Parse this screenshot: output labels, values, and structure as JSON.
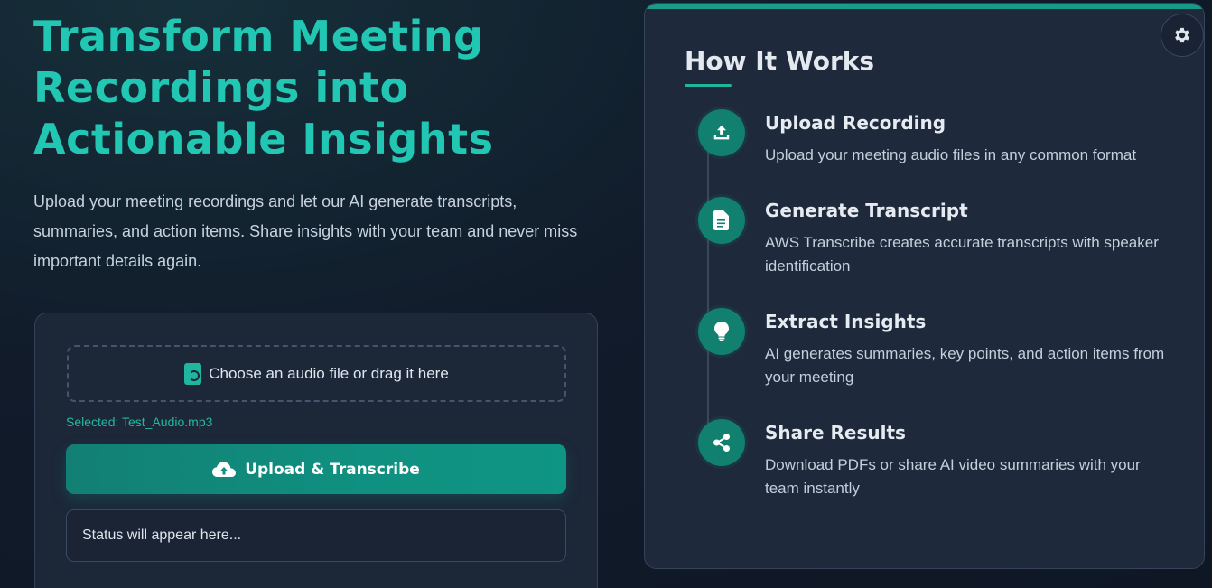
{
  "hero": {
    "title": "Transform Meeting Recordings into Actionable Insights",
    "subtitle": "Upload your meeting recordings and let our AI generate transcripts, summaries, and action items. Share insights with your team and never miss important details again."
  },
  "upload": {
    "dropzone_label": "Choose an audio file or drag it here",
    "selected_text": "Selected: Test_Audio.mp3",
    "button_label": "Upload & Transcribe",
    "status_placeholder": "Status will appear here..."
  },
  "how_it_works": {
    "title": "How It Works",
    "steps": [
      {
        "title": "Upload Recording",
        "desc": "Upload your meeting audio files in any common format",
        "icon": "upload-icon"
      },
      {
        "title": "Generate Transcript",
        "desc": "AWS Transcribe creates accurate transcripts with speaker identification",
        "icon": "document-icon"
      },
      {
        "title": "Extract Insights",
        "desc": "AI generates summaries, key points, and action items from your meeting",
        "icon": "lightbulb-icon"
      },
      {
        "title": "Share Results",
        "desc": "Download PDFs or share AI video summaries with your team instantly",
        "icon": "share-icon"
      }
    ]
  },
  "theme": {
    "accent": "#22c7b4",
    "button": "#109080",
    "card_bg": "#1e293b",
    "page_bg": "#111b2a"
  },
  "icons": {
    "settings": "gear-icon",
    "file": "audio-file-icon",
    "cloud": "cloud-upload-icon"
  }
}
